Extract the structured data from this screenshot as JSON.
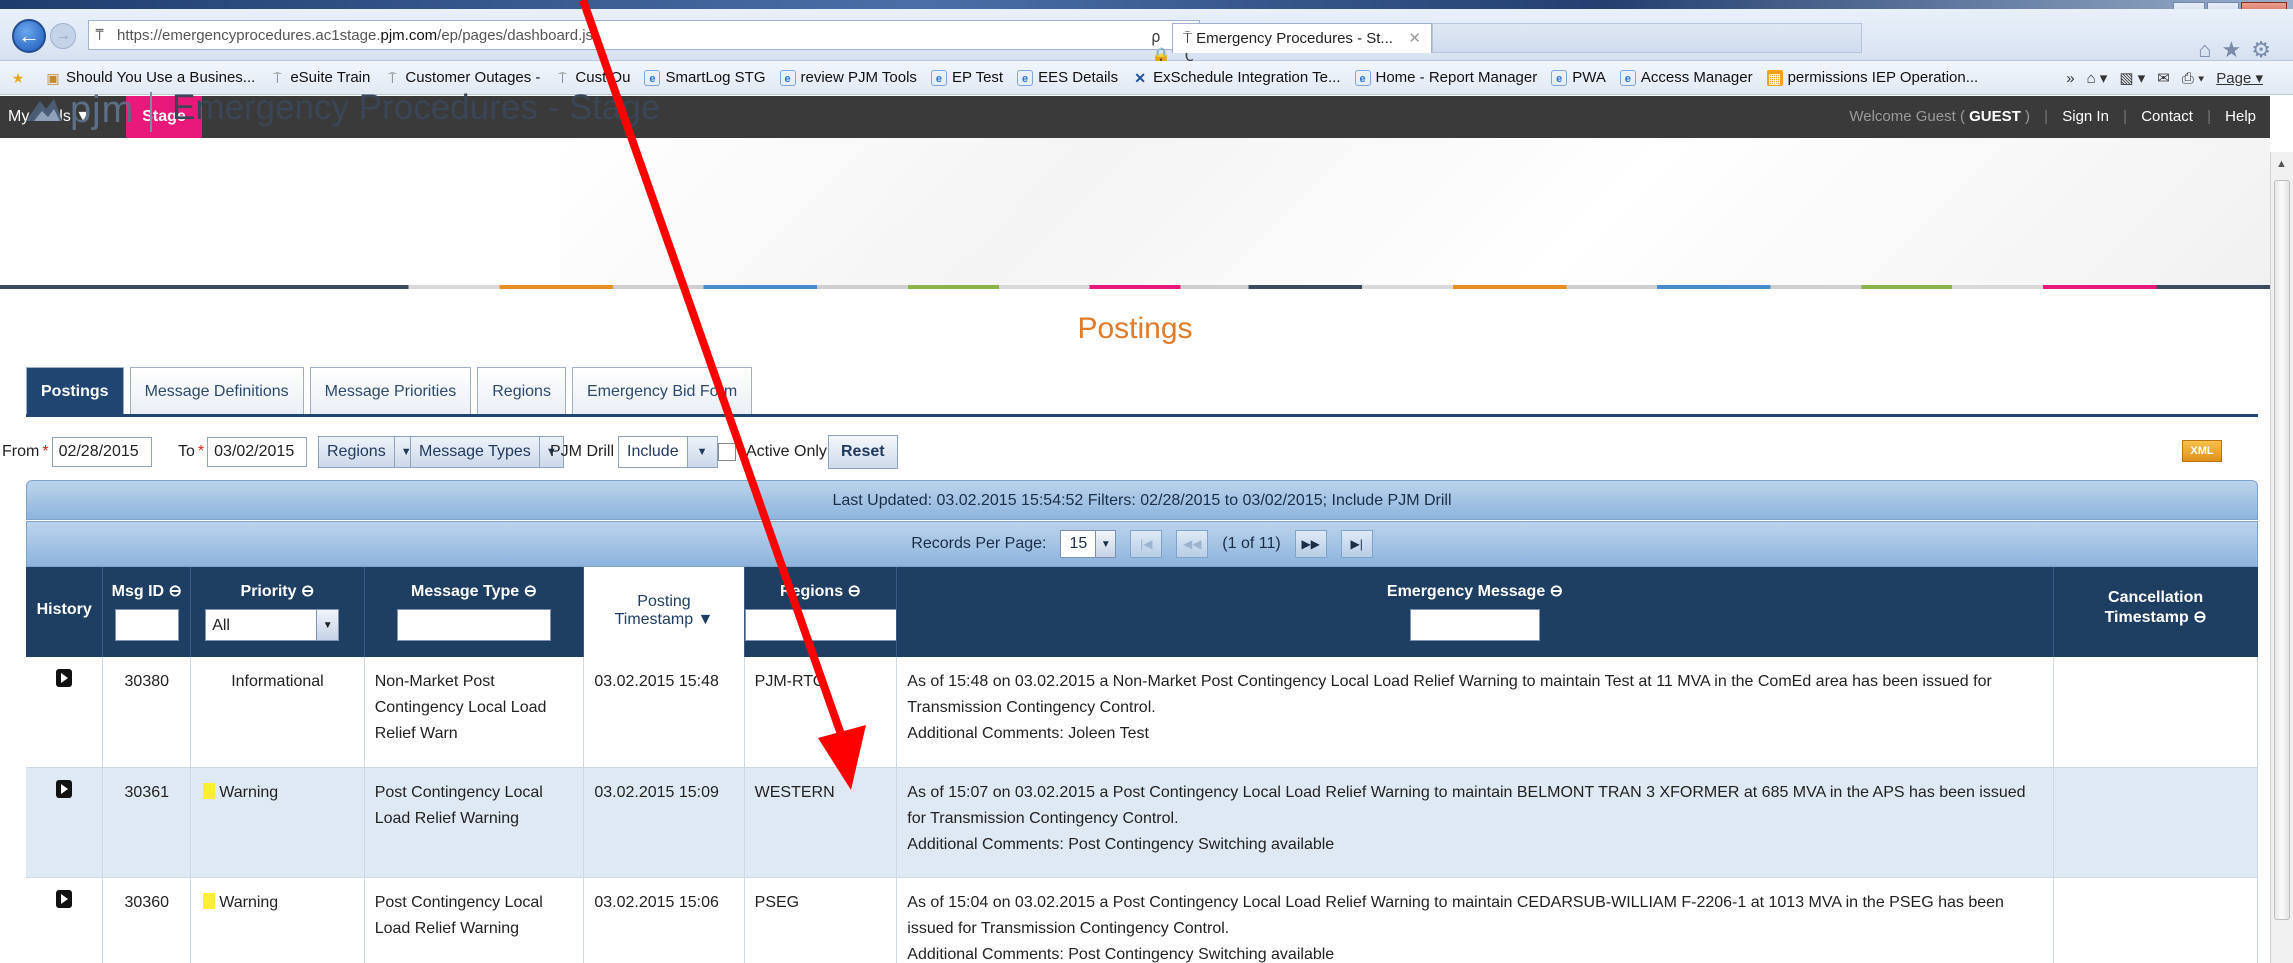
{
  "browser": {
    "url_prefix": "https://emergencyprocedures.ac1stage.",
    "url_domain": "pjm.com",
    "url_path": "/ep/pages/dashboard.jsf",
    "address_tools": "ρ ▾ 🔒 C ✕",
    "tab_title": "Emergency Procedures - St...",
    "tab_close": "✕",
    "favorites": [
      {
        "label": "Should You Use a Busines...",
        "icon": "star-icon"
      },
      {
        "label": "eSuite Train",
        "icon": "pin-icon"
      },
      {
        "label": "Customer Outages -",
        "icon": "pin-icon"
      },
      {
        "label": "Cust Ou",
        "icon": "pin-icon"
      },
      {
        "label": "SmartLog STG",
        "icon": "ie-icon"
      },
      {
        "label": "review PJM Tools",
        "icon": "ie-icon"
      },
      {
        "label": "EP Test",
        "icon": "ie-icon"
      },
      {
        "label": "EES Details",
        "icon": "ie-icon"
      },
      {
        "label": "ExSchedule Integration Te...",
        "icon": "tool-icon"
      },
      {
        "label": "Home - Report Manager",
        "icon": "ie-icon"
      },
      {
        "label": "PWA",
        "icon": "ie-icon"
      },
      {
        "label": "Access Manager",
        "icon": "ie-icon"
      },
      {
        "label": "permissions IEP Operation...",
        "icon": "folder-icon"
      }
    ],
    "command_bar": {
      "more": "»",
      "page_label": "Page ▾"
    }
  },
  "topnav": {
    "my_tools": "My Tools ▼",
    "stage": "Stage",
    "welcome_prefix": "Welcome Guest (",
    "welcome_user": "GUEST",
    "welcome_suffix": ")",
    "sign_in": "Sign In",
    "contact": "Contact",
    "help": "Help"
  },
  "header": {
    "logo_text": "pjm",
    "app_title": "Emergency Procedures - Stage"
  },
  "page": {
    "heading": "Postings",
    "tabs": [
      {
        "label": "Postings",
        "active": true
      },
      {
        "label": "Message Definitions",
        "active": false
      },
      {
        "label": "Message Priorities",
        "active": false
      },
      {
        "label": "Regions",
        "active": false
      },
      {
        "label": "Emergency Bid Form",
        "active": false
      }
    ]
  },
  "filters": {
    "from_label": "From",
    "from_value": "02/28/2015",
    "to_label": "To",
    "to_value": "03/02/2015",
    "regions_button": "Regions",
    "message_types_button": "Message Types",
    "pjm_drill_label": "PJM Drill",
    "pjm_drill_value": "Include",
    "active_only_label": "Active Only",
    "reset_label": "Reset",
    "required_mark": "*",
    "xml_icon_label": "XML"
  },
  "grid": {
    "last_updated": "Last Updated: 03.02.2015 15:54:52  Filters: 02/28/2015 to 03/02/2015; Include PJM Drill",
    "records_per_page_label": "Records Per Page:",
    "records_per_page_value": "15",
    "page_info": "(1 of 11)",
    "columns": {
      "history": "History",
      "msg_id": "Msg ID ⊖",
      "priority": "Priority ⊖",
      "priority_filter": "All",
      "message_type": "Message Type ⊖",
      "posting_timestamp_1": "Posting",
      "posting_timestamp_2": "Timestamp ▼",
      "regions": "Regions ⊖",
      "emergency_message": "Emergency Message ⊖",
      "cancellation_1": "Cancellation",
      "cancellation_2": "Timestamp ⊖"
    },
    "rows": [
      {
        "msg_id": "30380",
        "priority": "Informational",
        "priority_color": "",
        "message_type": "Non-Market Post Contingency Local Load Relief Warn",
        "posting_timestamp": "03.02.2015 15:48",
        "region": "PJM-RTO",
        "message": "As of 15:48 on 03.02.2015 a Non-Market Post Contingency Local Load Relief Warning to maintain Test at 11 MVA in the ComEd area has been issued for Transmission Contingency Control.",
        "comments": "Additional Comments: Joleen Test",
        "cancellation": ""
      },
      {
        "msg_id": "30361",
        "priority": "Warning",
        "priority_color": "#ffee33",
        "message_type": "Post Contingency Local Load Relief Warning",
        "posting_timestamp": "03.02.2015 15:09",
        "region": "WESTERN",
        "message": "As of 15:07 on 03.02.2015 a Post Contingency Local Load Relief Warning to maintain BELMONT TRAN 3 XFORMER at 685 MVA in the APS has been issued for Transmission Contingency Control.",
        "comments": "Additional Comments: Post Contingency Switching available",
        "cancellation": ""
      },
      {
        "msg_id": "30360",
        "priority": "Warning",
        "priority_color": "#ffee33",
        "message_type": "Post Contingency Local Load Relief Warning",
        "posting_timestamp": "03.02.2015 15:06",
        "region": "PSEG",
        "message": "As of 15:04 on 03.02.2015 a Post Contingency Local Load Relief Warning to maintain CEDARSUB-WILLIAM F-2206-1 at 1013 MVA in the PSEG has been issued for Transmission Contingency Control.",
        "comments": "Additional Comments: Post Contingency Switching available",
        "cancellation": ""
      }
    ]
  },
  "colors": {
    "topnav_bg": "#3a3a3a",
    "stage_badge": "#e8197a",
    "heading_orange": "#e07b2a",
    "grid_header": "#1e3e62",
    "warning_swatch": "#ffee33",
    "annotation_arrow": "#ff0000"
  }
}
